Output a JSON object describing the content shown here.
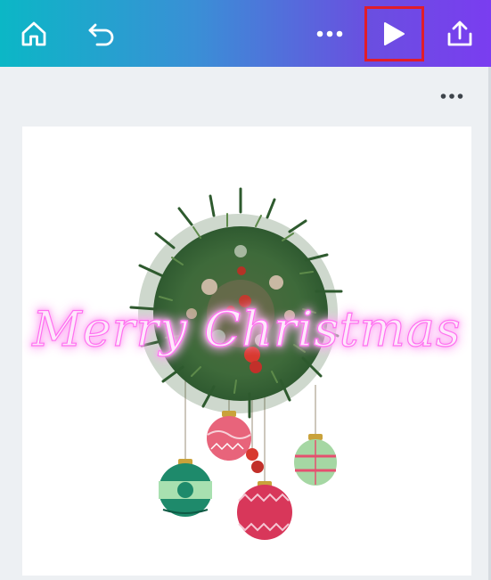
{
  "toolbar": {
    "home_icon": "home-icon",
    "undo_icon": "undo-icon",
    "more_icon": "more-horizontal-icon",
    "play_icon": "play-icon",
    "share_icon": "share-upload-icon",
    "highlight_color": "#e11d2a"
  },
  "page_menu": {
    "icon": "more-horizontal-icon"
  },
  "design": {
    "title_text": "Merry Christmas",
    "glow_color": "#ff6ff0"
  }
}
